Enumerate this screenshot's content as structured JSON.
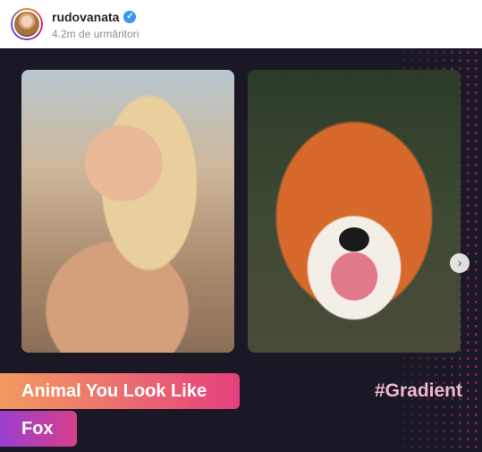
{
  "account": {
    "username": "rudovanata",
    "followers": "4.2m de urmăritori",
    "verified_glyph": "✓"
  },
  "post": {
    "label_main": "Animal You Look Like",
    "label_result": "Fox",
    "hashtag": "#Gradient",
    "next_glyph": "›"
  },
  "colors": {
    "post_background": "#1b1825",
    "verified_badge": "#3897f0",
    "hashtag": "#f0b8d2"
  },
  "icons": {
    "verified": "verified-check-icon",
    "carousel_next": "chevron-right-icon"
  }
}
